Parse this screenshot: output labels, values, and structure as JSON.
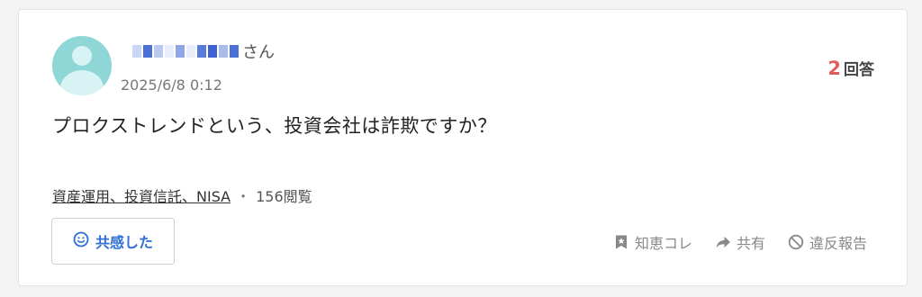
{
  "user": {
    "suffix": "さん",
    "date": "2025/6/8 0:12"
  },
  "answers": {
    "count": "2",
    "unit": "回答"
  },
  "question": {
    "text": "プロクストレンドという、投資会社は詐欺ですか？"
  },
  "tags": {
    "category": "資産運用、投資信託、NISA",
    "separator": "・",
    "views": "156閲覧"
  },
  "buttons": {
    "empathy": "共感した",
    "chiebukuro": "知恵コレ",
    "share": "共有",
    "report": "違反報告"
  },
  "colors": {
    "accent": "#2f6fd6",
    "answer_count": "#e05d5d",
    "avatar": "#8fd6d6"
  },
  "icons": {
    "empathy": "smile-icon",
    "chiebukuro": "bookmark-star-icon",
    "share": "share-arrow-icon",
    "report": "prohibited-icon"
  }
}
